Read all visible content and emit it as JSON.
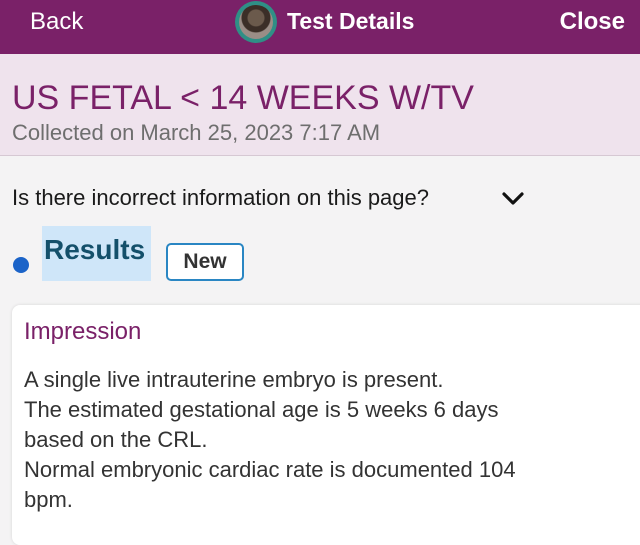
{
  "nav": {
    "back_label": "Back",
    "title": "Test Details",
    "close_label": "Close"
  },
  "header": {
    "test_name": "US FETAL < 14 WEEKS W/TV",
    "collected": "Collected on March 25, 2023 7:17 AM"
  },
  "feedback": {
    "question": "Is there incorrect information on this page?"
  },
  "results": {
    "label": "Results",
    "badge": "New"
  },
  "impression": {
    "title": "Impression",
    "lines": [
      "A single live intrauterine embryo is present.",
      "The estimated gestational age is 5 weeks 6 days",
      "based on the CRL.",
      "Normal embryonic cardiac rate is documented 104",
      "bpm."
    ]
  },
  "colors": {
    "brand": "#7a2168",
    "header_bg": "#efe3ed",
    "accent_blue": "#1b63c8",
    "highlight": "#cfe6f9"
  },
  "icons": {
    "avatar": "avatar-photo",
    "chevron": "chevron-down-icon",
    "dot": "unread-dot"
  }
}
